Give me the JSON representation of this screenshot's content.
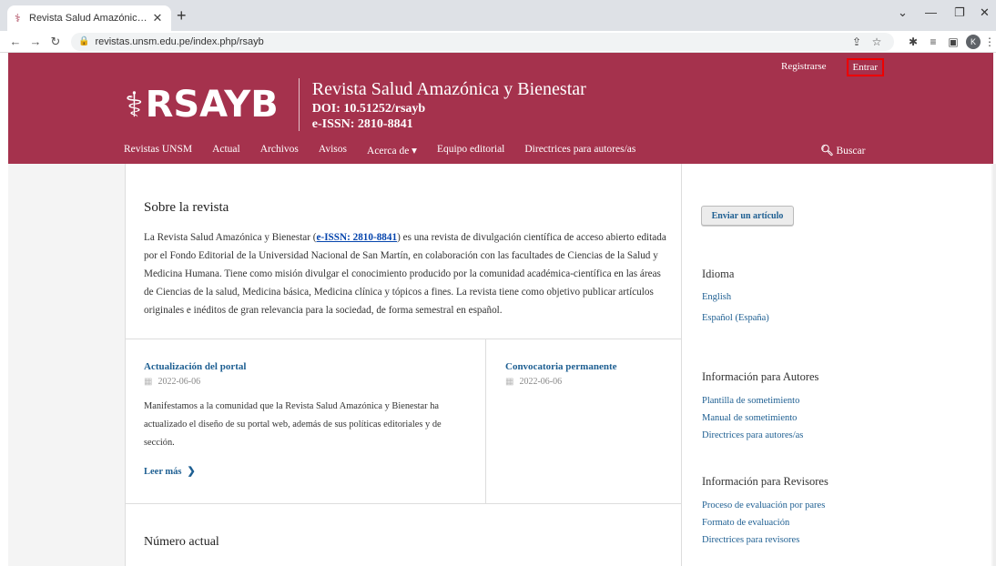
{
  "browser": {
    "tab_title": "Revista Salud Amazónica y Biene",
    "tab_close": "✕",
    "new_tab": "+",
    "url": "revistas.unsm.edu.pe/index.php/rsayb",
    "profile_initial": "K",
    "icons": [
      "back-arrow-icon",
      "forward-arrow-icon",
      "reload-icon",
      "lock-icon",
      "share-icon",
      "star-icon",
      "extensions-icon",
      "reading-list-icon",
      "side-panel-icon",
      "menu-dots-icon"
    ]
  },
  "header": {
    "register": "Registrarse",
    "login": "Entrar",
    "logo_text": "RSAYB",
    "journal_name": "Revista Salud Amazónica y Bienestar",
    "doi": "DOI: 10.51252/rsayb",
    "eissn": "e-ISSN: 2810-8841",
    "bg_color": "#a5324d"
  },
  "nav": {
    "items": [
      "Revistas UNSM",
      "Actual",
      "Archivos",
      "Avisos",
      "Acerca de ▾",
      "Equipo editorial",
      "Directrices para autores/as"
    ],
    "search": "Buscar"
  },
  "about": {
    "title": "Sobre la revista",
    "text_before": "La Revista Salud Amazónica y Bienestar (",
    "issn_link": "e-ISSN: 2810-8841",
    "text_after": ") es una revista de divulgación científica de acceso abierto editada por el Fondo Editorial de la Universidad Nacional de San Martín, en colaboración con las facultades de Ciencias de la Salud y Medicina Humana. Tiene como misión divulgar el conocimiento producido por la comunidad académica-científica en las áreas de Ciencias de la salud, Medicina básica, Medicina clínica y tópicos a fines. La revista tiene como objetivo publicar artículos originales e inéditos de gran relevancia para la sociedad, de forma semestral en español."
  },
  "announcements": [
    {
      "title": "Actualización del portal",
      "date": "2022-06-06",
      "body": "Manifestamos a la comunidad que la Revista Salud Amazónica y Bienestar ha actualizado el diseño de su portal web, además de sus políticas editoriales y de sección.",
      "read_more": "Leer más"
    },
    {
      "title": "Convocatoria permanente",
      "date": "2022-06-06"
    }
  ],
  "current_issue": {
    "title": "Número actual"
  },
  "sidebar": {
    "submit": "Enviar un artículo",
    "language": {
      "title": "Idioma",
      "items": [
        "English",
        "Español (España)"
      ]
    },
    "authors": {
      "title": "Información para Autores",
      "items": [
        "Plantilla de sometimiento",
        "Manual de sometimiento",
        "Directrices para autores/as"
      ]
    },
    "reviewers": {
      "title": "Información para Revisores",
      "items": [
        "Proceso de evaluación por pares",
        "Formato de evaluación",
        "Directrices para revisores"
      ]
    }
  }
}
